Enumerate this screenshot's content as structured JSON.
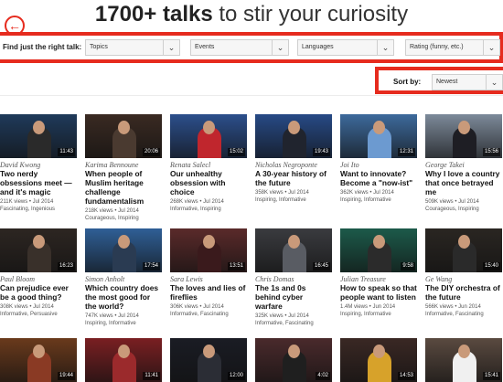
{
  "header": {
    "headline_bold": "1700+ talks",
    "headline_rest": " to stir your curiosity"
  },
  "filters": {
    "label": "Find just the right talk:",
    "topics": "Topics",
    "events": "Events",
    "languages": "Languages",
    "rating": "Rating (funny, etc.)"
  },
  "sort": {
    "label": "Sort by:",
    "value": "Newest"
  },
  "colors": {
    "accent": "#e62b1e"
  },
  "icons": {
    "back": "back-arrow-icon",
    "dropdown": "chevron-down-icon"
  },
  "talks": [
    {
      "speaker": "David Kwong",
      "title": "Two nerdy obsessions meet — and it's magic",
      "views": "211K views • Jul 2014",
      "tags": "Fascinating, Ingenious",
      "duration": "11:43",
      "bg": "#1f3a5a",
      "shirt": "#2a2a2a"
    },
    {
      "speaker": "Karima Bennoune",
      "title": "When people of Muslim heritage challenge fundamentalism",
      "views": "218K views • Jul 2014",
      "tags": "Courageous, Inspiring",
      "duration": "20:06",
      "bg": "#3a2a22",
      "shirt": "#4a3a30"
    },
    {
      "speaker": "Renata Salecl",
      "title": "Our unhealthy obsession with choice",
      "views": "268K views • Jul 2014",
      "tags": "Informative, Inspiring",
      "duration": "15:02",
      "bg": "#2c4f8c",
      "shirt": "#c0262d"
    },
    {
      "speaker": "Nicholas Negroponte",
      "title": "A 30-year history of the future",
      "views": "358K views • Jul 2014",
      "tags": "Inspiring, Informative",
      "duration": "19:43",
      "bg": "#274a86",
      "shirt": "#20242e"
    },
    {
      "speaker": "Joi Ito",
      "title": "Want to innovate? Become a \"now-ist\"",
      "views": "362K views • Jul 2014",
      "tags": "Inspiring, Informative",
      "duration": "12:31",
      "bg": "#3d6a9c",
      "shirt": "#6c9ad0"
    },
    {
      "speaker": "George Takei",
      "title": "Why I love a country that once betrayed me",
      "views": "509K views • Jul 2014",
      "tags": "Courageous, Inspiring",
      "duration": "15:56",
      "bg": "#7d8a9a",
      "shirt": "#1e1e24"
    },
    {
      "speaker": "Paul Bloom",
      "title": "Can prejudice ever be a good thing?",
      "views": "308K views • Jul 2014",
      "tags": "Informative, Persuasive",
      "duration": "16:23",
      "bg": "#2d2622",
      "shirt": "#39302a"
    },
    {
      "speaker": "Simon Anholt",
      "title": "Which country does the most good for the world?",
      "views": "747K views • Jul 2014",
      "tags": "Inspiring, Informative",
      "duration": "17:54",
      "bg": "#2f5f96",
      "shirt": "#2a3b52"
    },
    {
      "speaker": "Sara Lewis",
      "title": "The loves and lies of fireflies",
      "views": "306K views • Jul 2014",
      "tags": "Informative, Fascinating",
      "duration": "13:51",
      "bg": "#5a2a2a",
      "shirt": "#3a1a1c"
    },
    {
      "speaker": "Chris Domas",
      "title": "The 1s and 0s behind cyber warfare",
      "views": "325K views • Jul 2014",
      "tags": "Informative, Fascinating",
      "duration": "16:45",
      "bg": "#3a3b3f",
      "shirt": "#595c63"
    },
    {
      "speaker": "Julian Treasure",
      "title": "How to speak so that people want to listen",
      "views": "1.4M views • Jun 2014",
      "tags": "Inspiring, Informative",
      "duration": "9:58",
      "bg": "#1c5a4a",
      "shirt": "#2b2b2b"
    },
    {
      "speaker": "Ge Wang",
      "title": "The DIY orchestra of the future",
      "views": "566K views • Jun 2014",
      "tags": "Informative, Fascinating",
      "duration": "15:40",
      "bg": "#2a2622",
      "shirt": "#2a2a2a"
    },
    {
      "speaker": "",
      "title": "",
      "views": "",
      "tags": "",
      "duration": "19:44",
      "bg": "#6a3a1c",
      "shirt": "#8a3a24"
    },
    {
      "speaker": "",
      "title": "",
      "views": "",
      "tags": "",
      "duration": "11:41",
      "bg": "#7a1f22",
      "shirt": "#9b2a2c"
    },
    {
      "speaker": "",
      "title": "",
      "views": "",
      "tags": "",
      "duration": "12:00",
      "bg": "#1a1c24",
      "shirt": "#2b2d35"
    },
    {
      "speaker": "",
      "title": "",
      "views": "",
      "tags": "",
      "duration": "4:02",
      "bg": "#4a2a2c",
      "shirt": "#1f1f1f"
    },
    {
      "speaker": "",
      "title": "",
      "views": "",
      "tags": "",
      "duration": "14:53",
      "bg": "#3a2824",
      "shirt": "#d7a22a"
    },
    {
      "speaker": "",
      "title": "",
      "views": "",
      "tags": "",
      "duration": "15:41",
      "bg": "#5a4a40",
      "shirt": "#f0f0f0"
    }
  ]
}
